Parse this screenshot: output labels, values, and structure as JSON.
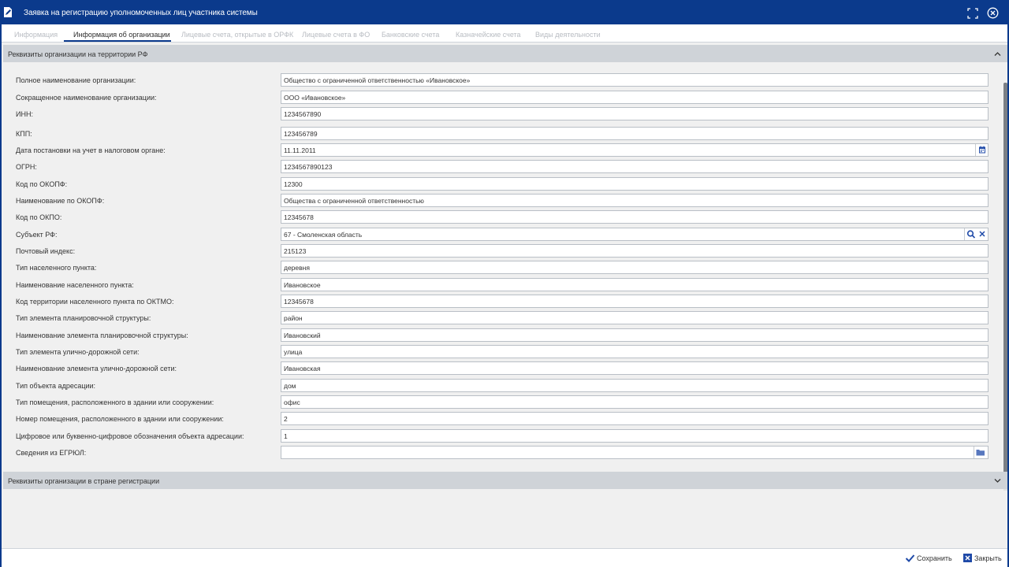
{
  "window": {
    "title": "Заявка на регистрацию уполномоченных лиц участника системы"
  },
  "tabs": [
    {
      "label": "Информация"
    },
    {
      "label": "Информация об организации"
    },
    {
      "label": "Лицевые счета, открытые в ОРФК"
    },
    {
      "label": "Лицевые счета в ФО"
    },
    {
      "label": "Банковские счета"
    },
    {
      "label": "Казначейские счета"
    },
    {
      "label": "Виды деятельности"
    }
  ],
  "section_rf": {
    "title": "Реквизиты организации на территории РФ"
  },
  "section_foreign": {
    "title": "Реквизиты организации в стране регистрации"
  },
  "fields": [
    {
      "label": "Полное наименование организации:",
      "value": "Общество с ограниченной ответственностью «Ивановское»"
    },
    {
      "label": "Сокращенное наименование организации:",
      "value": "ООО «Ивановское»"
    },
    {
      "label": "ИНН:",
      "value": "1234567890"
    },
    {
      "label": "КПП:",
      "value": "123456789"
    },
    {
      "label": "Дата постановки на учет в налоговом органе:",
      "value": "11.11.2011"
    },
    {
      "label": "ОГРН:",
      "value": "1234567890123"
    },
    {
      "label": "Код по ОКОПФ:",
      "value": "12300"
    },
    {
      "label": "Наименование по ОКОПФ:",
      "value": "Общества с ограниченной ответственностью"
    },
    {
      "label": "Код по ОКПО:",
      "value": "12345678"
    },
    {
      "label": "Субъект РФ:",
      "value": "67 - Смоленская область"
    },
    {
      "label": "Почтовый индекс:",
      "value": "215123"
    },
    {
      "label": "Тип населенного пункта:",
      "value": "деревня"
    },
    {
      "label": "Наименование населенного пункта:",
      "value": "Ивановское"
    },
    {
      "label": "Код территории населенного пункта по ОКТМО:",
      "value": "12345678"
    },
    {
      "label": "Тип элемента планировочной структуры:",
      "value": "район"
    },
    {
      "label": "Наименование элемента планировочной структуры:",
      "value": "Ивановский"
    },
    {
      "label": "Тип элемента улично-дорожной сети:",
      "value": "улица"
    },
    {
      "label": "Наименование элемента улично-дорожной сети:",
      "value": "Ивановская"
    },
    {
      "label": "Тип объекта адресации:",
      "value": "дом"
    },
    {
      "label": "Тип помещения, расположенного в здании или сооружении:",
      "value": "офис"
    },
    {
      "label": "Номер помещения, расположенного в здании или сооружении:",
      "value": "2"
    },
    {
      "label": "Цифровое или буквенно-цифровое обозначения объекта адресации:",
      "value": "1"
    },
    {
      "label": "Сведения из ЕГРЮЛ:",
      "value": ""
    }
  ],
  "footer": {
    "save_label": "Сохранить",
    "close_label": "Закрыть"
  },
  "colors": {
    "titlebar": "#0b3a8c",
    "icon_blue": "#1f4aa8",
    "section_header": "#cfd3d8"
  }
}
